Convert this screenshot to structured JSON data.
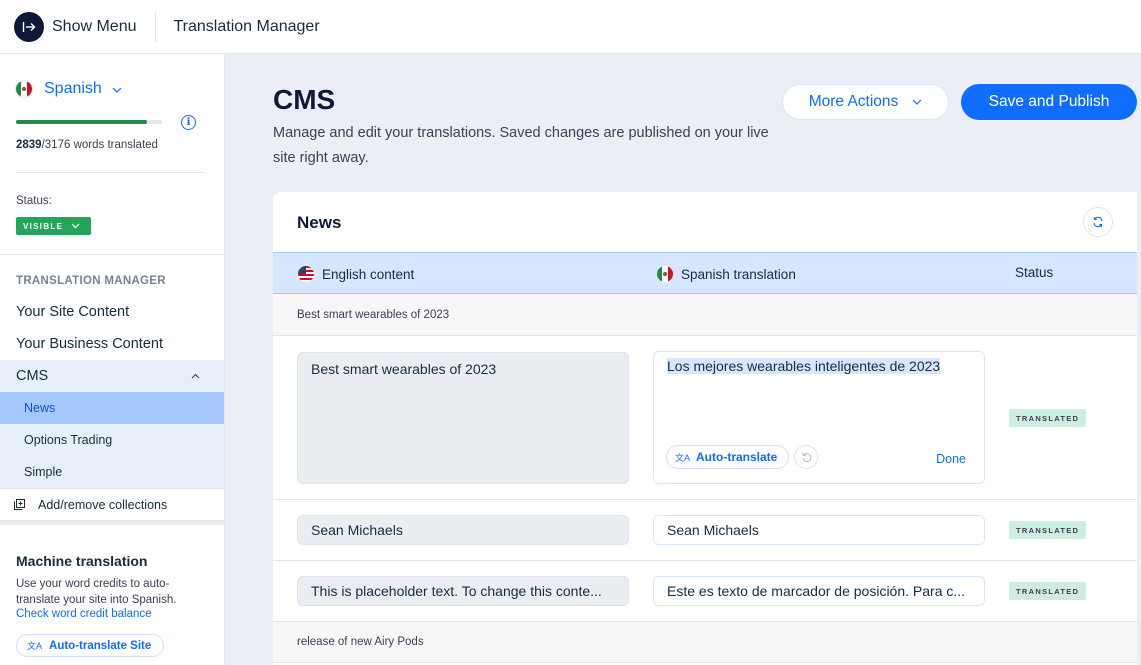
{
  "topbar": {
    "show_menu_label": "Show Menu",
    "app_title": "Translation Manager"
  },
  "sidebar": {
    "language": "Spanish",
    "progress": {
      "translated": 2839,
      "total": 3176,
      "fraction": 0.894
    },
    "translated_count": "2839",
    "total_words_text": "/3176 words translated",
    "status_label": "Status:",
    "status_value": "VISIBLE",
    "section_heading": "TRANSLATION MANAGER",
    "nav": [
      {
        "label": "Your Site Content"
      },
      {
        "label": "Your Business Content"
      },
      {
        "label": "CMS",
        "expanded": true
      }
    ],
    "cms_items": [
      {
        "label": "News",
        "active": true
      },
      {
        "label": "Options Trading"
      },
      {
        "label": "Simple"
      }
    ],
    "add_collections_label": "Add/remove collections",
    "machine_translation": {
      "title": "Machine translation",
      "description": "Use your word credits to auto-translate your site into Spanish.",
      "link": "Check word credit balance",
      "button": "Auto-translate Site"
    }
  },
  "main": {
    "title": "CMS",
    "description": "Manage and edit your translations. Saved changes are published on your live site right away.",
    "more_actions_label": "More Actions",
    "save_publish_label": "Save and Publish",
    "card": {
      "title": "News",
      "columns": {
        "source": "English content",
        "target": "Spanish translation",
        "status": "Status"
      },
      "groups": [
        {
          "label": "Best smart wearables of 2023",
          "rows": [
            {
              "source": "Best smart wearables of 2023",
              "target": "Los mejores wearables inteligentes de 2023",
              "status": "TRANSLATED",
              "editing": true
            },
            {
              "source": "Sean Michaels",
              "target": "Sean Michaels",
              "status": "TRANSLATED"
            },
            {
              "source": "This is placeholder text. To change this conte...",
              "target": "Este es texto de marcador de posición. Para c...",
              "status": "TRANSLATED"
            }
          ]
        },
        {
          "label": "release of new Airy Pods",
          "rows": []
        }
      ],
      "editor": {
        "auto_translate_label": "Auto-translate",
        "done_label": "Done"
      }
    }
  },
  "colors": {
    "accent": "#116dff",
    "progress": "#1f8a4c",
    "visible_badge": "#25a55a",
    "translated_badge": "#cfece0",
    "header_row": "#d6e6fe"
  }
}
